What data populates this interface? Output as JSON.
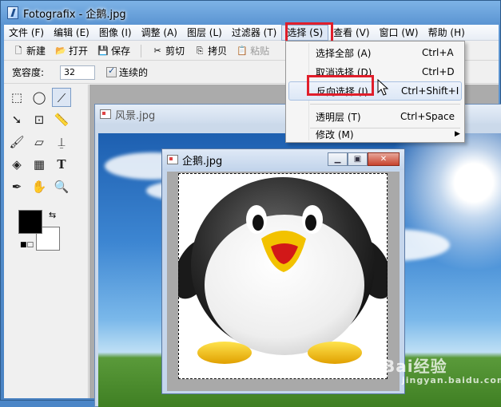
{
  "window": {
    "title": "Fotografix - 企鹅.jpg"
  },
  "menubar": {
    "items": [
      {
        "label": "文件 (F)"
      },
      {
        "label": "编辑 (E)"
      },
      {
        "label": "图像 (I)"
      },
      {
        "label": "调整 (A)"
      },
      {
        "label": "图层 (L)"
      },
      {
        "label": "过滤器 (T)"
      },
      {
        "label": "选择 (S)"
      },
      {
        "label": "查看 (V)"
      },
      {
        "label": "窗口 (W)"
      },
      {
        "label": "帮助 (H)"
      }
    ]
  },
  "toolbar": {
    "new_label": "新建",
    "open_label": "打开",
    "save_label": "保存",
    "cut_label": "剪切",
    "copy_label": "拷贝",
    "paste_label": "粘贴"
  },
  "options": {
    "tolerance_label": "宽容度:",
    "tolerance_value": "32",
    "contiguous_label": "连续的",
    "contiguous_checked": true
  },
  "documents": {
    "landscape_title": "风景.jpg",
    "penguin_title": "企鹅.jpg"
  },
  "select_menu": {
    "items": [
      {
        "label": "选择全部 (A)",
        "shortcut": "Ctrl+A"
      },
      {
        "label": "取消选择 (D)",
        "shortcut": "Ctrl+D"
      },
      {
        "label": "反向选择 (I)",
        "shortcut": "Ctrl+Shift+I"
      },
      {
        "label": "透明层 (T)",
        "shortcut": "Ctrl+Space"
      },
      {
        "label": "修改 (M)",
        "shortcut": ""
      }
    ]
  },
  "watermark": {
    "brand": "Bai经验",
    "sub": "jingyan.baidu.com"
  },
  "colors": {
    "highlight_border": "#e01e2b",
    "foreground": "#000000",
    "background": "#ffffff"
  },
  "icons": [
    "app-icon",
    "new-icon",
    "open-icon",
    "save-icon",
    "cut-icon",
    "copy-icon",
    "paste-icon",
    "rect-select-icon",
    "ellipse-select-icon",
    "magic-wand-icon",
    "move-icon",
    "crop-icon",
    "measure-icon",
    "brush-icon",
    "eraser-icon",
    "stamp-icon",
    "fill-icon",
    "gradient-icon",
    "text-icon",
    "eyedropper-icon",
    "hand-icon",
    "zoom-icon",
    "swap-colors-icon",
    "reset-colors-icon",
    "submenu-arrow-icon",
    "mouse-cursor-icon"
  ]
}
